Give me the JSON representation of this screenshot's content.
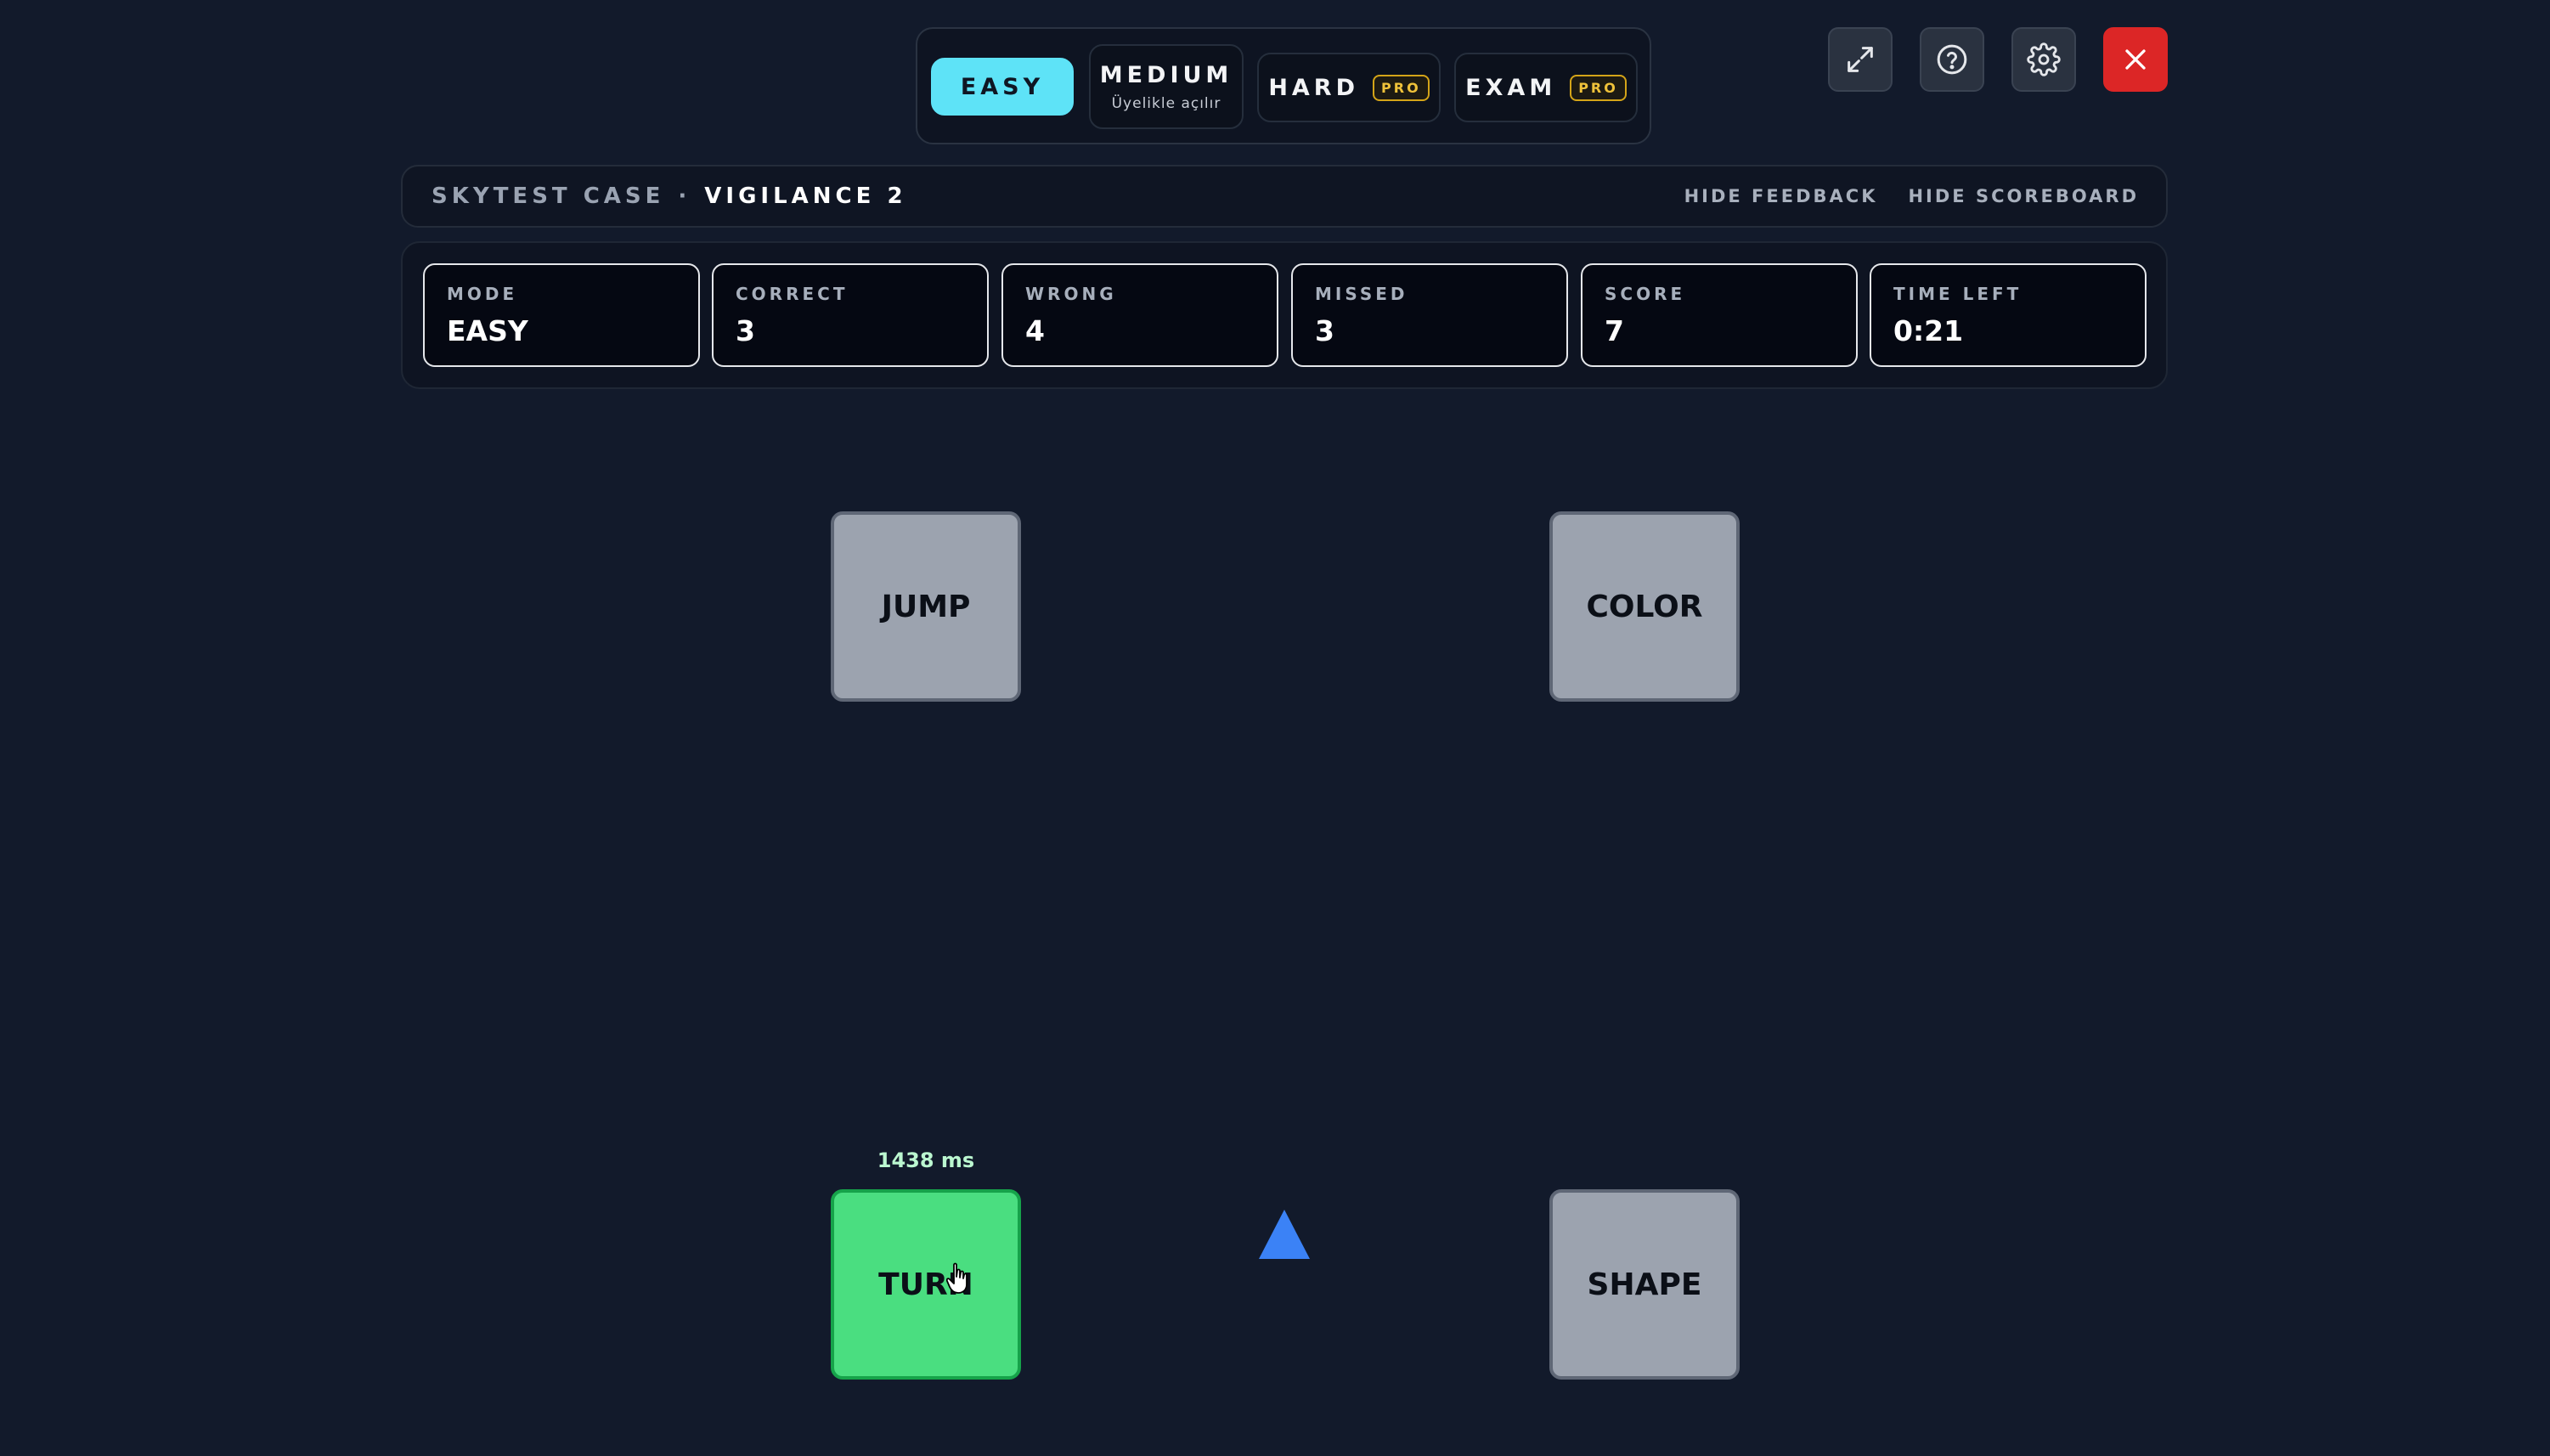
{
  "difficulty_tabs": {
    "easy": {
      "label": "EASY"
    },
    "medium": {
      "label": "MEDIUM",
      "sub": "Üyelikle açılır"
    },
    "hard": {
      "label": "HARD",
      "badge": "PRO"
    },
    "exam": {
      "label": "EXAM",
      "badge": "PRO"
    },
    "selected": "EASY"
  },
  "toolbar": {
    "icons": [
      "expand-icon",
      "help-icon",
      "settings-icon",
      "close-icon"
    ]
  },
  "title_bar": {
    "case_label": "SKYTEST CASE",
    "separator": "·",
    "test_name": "VIGILANCE 2",
    "hide_feedback": "HIDE FEEDBACK",
    "hide_scoreboard": "HIDE SCOREBOARD"
  },
  "scoreboard": {
    "stats": [
      {
        "label": "MODE",
        "value": "EASY"
      },
      {
        "label": "CORRECT",
        "value": "3"
      },
      {
        "label": "WRONG",
        "value": "4"
      },
      {
        "label": "MISSED",
        "value": "3"
      },
      {
        "label": "SCORE",
        "value": "7"
      },
      {
        "label": "TIME LEFT",
        "value": "0:21"
      }
    ]
  },
  "tiles": {
    "top_left": "JUMP",
    "top_right": "COLOR",
    "bottom_left": "TURN",
    "bottom_right": "SHAPE",
    "active": "TURN"
  },
  "feedback": {
    "reaction_time": "1438 ms"
  },
  "stimulus": {
    "shape": "triangle",
    "color": "#3b82f6"
  },
  "colors": {
    "accent": "#5ee3f7",
    "active_tile": "#4ade80",
    "close_button": "#dc2626",
    "pro_badge": "#d4a418"
  }
}
